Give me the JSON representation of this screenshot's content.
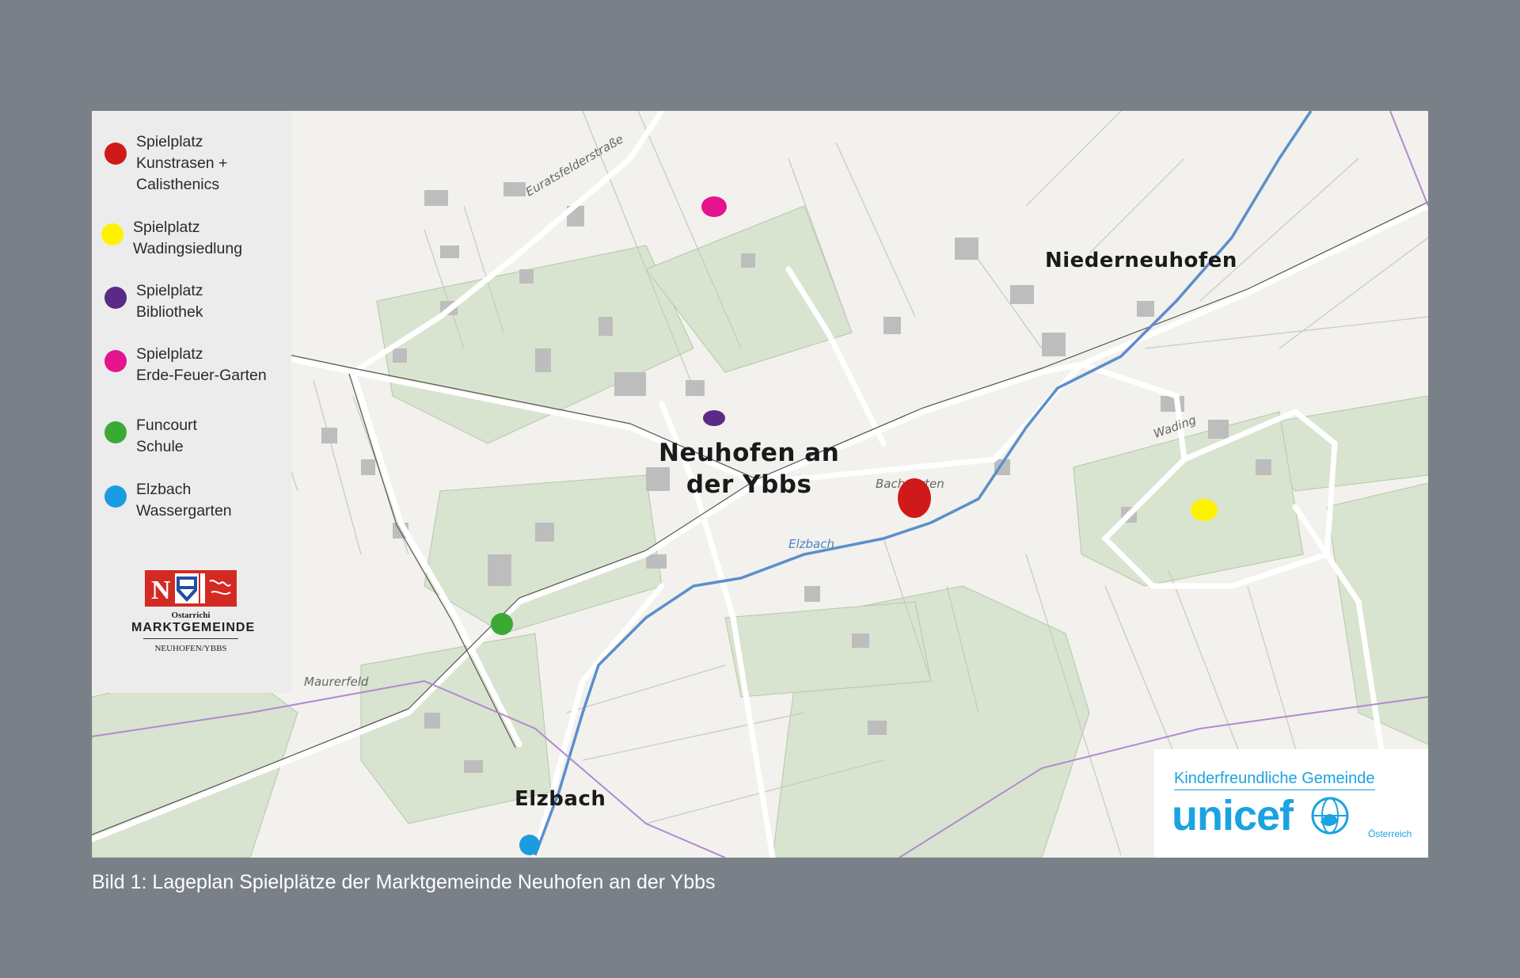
{
  "legend": {
    "items": [
      {
        "label": "Spielplatz\nKunstrasen +\nCalisthenics",
        "color": "#d01a1a"
      },
      {
        "label": "Spielplatz\nWadingsiedlung",
        "color": "#fff200"
      },
      {
        "label": "Spielplatz\nBibliothek",
        "color": "#5b2a86"
      },
      {
        "label": "Spielplatz\nErde-Feuer-Garten",
        "color": "#e5148c"
      },
      {
        "label": "Funcourt\nSchule",
        "color": "#3aaa35"
      },
      {
        "label": "Elzbach\nWassergarten",
        "color": "#1a9de0"
      }
    ],
    "coat_of_arms": {
      "line1": "Ostarrichi",
      "line2": "MARKTGEMEINDE",
      "line3": "NEUHOFEN/YBBS"
    }
  },
  "map": {
    "places": {
      "main_town": "Neuhofen an\nder Ybbs",
      "niederneuhofen": "Niederneuhofen",
      "elzbach": "Elzbach"
    },
    "streets": {
      "euratsfelder": "Euratsfelderstraße",
      "maurerfeld": "Maurerfeld",
      "elzbach_river": "Elzbach",
      "bachgarten": "Bachgarten",
      "wading": "Wading"
    }
  },
  "unicef": {
    "heading": "Kinderfreundliche Gemeinde",
    "wordmark": "unicef",
    "country": "Österreich",
    "color": "#1ba3e1"
  },
  "caption": "Bild 1: Lageplan Spielplätze der Marktgemeinde Neuhofen an der Ybbs"
}
